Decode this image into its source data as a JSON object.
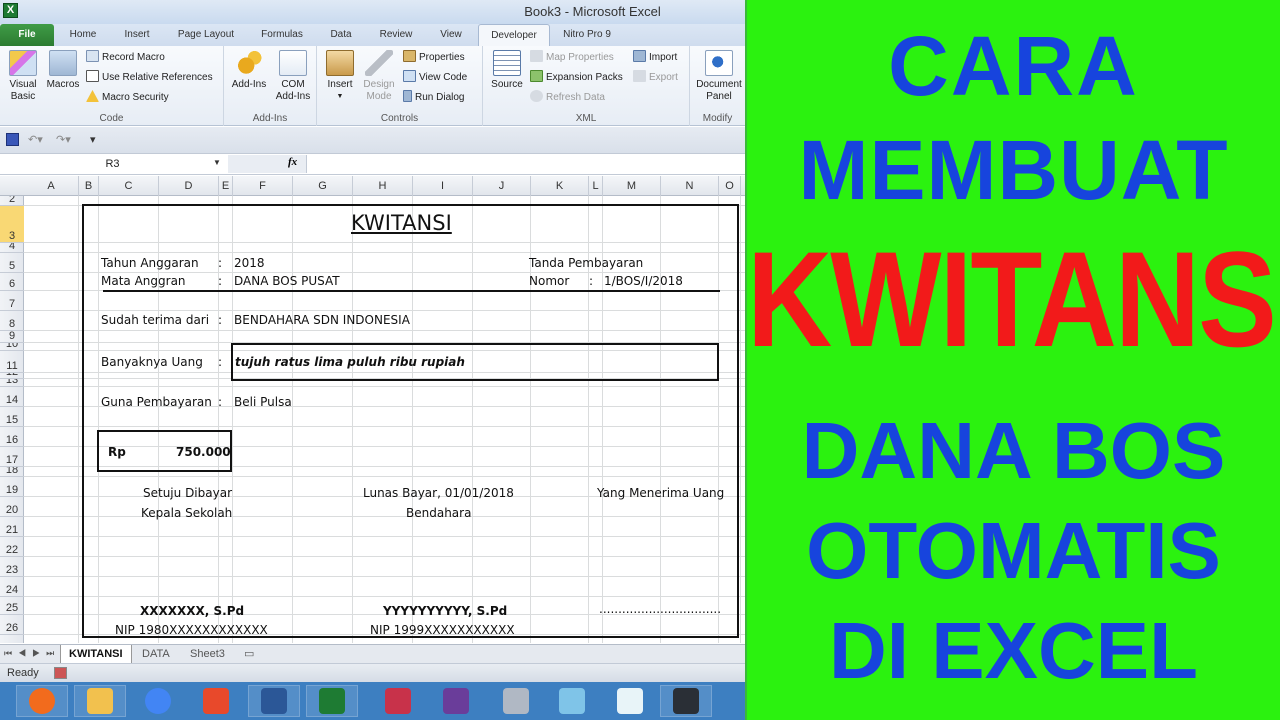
{
  "window": {
    "title": "Book3 - Microsoft Excel",
    "app_icon": "excel-icon"
  },
  "ribbon_tabs": [
    {
      "label": "File"
    },
    {
      "label": "Home"
    },
    {
      "label": "Insert"
    },
    {
      "label": "Page Layout"
    },
    {
      "label": "Formulas"
    },
    {
      "label": "Data"
    },
    {
      "label": "Review"
    },
    {
      "label": "View"
    },
    {
      "label": "Developer",
      "active": true
    },
    {
      "label": "Nitro Pro 9"
    }
  ],
  "ribbon": {
    "code": {
      "label": "Code",
      "visual_basic": "Visual Basic",
      "visual_basic_l1": "Visual",
      "visual_basic_l2": "Basic",
      "macros": "Macros",
      "record_macro": "Record Macro",
      "use_relative": "Use Relative References",
      "macro_security": "Macro Security"
    },
    "addins": {
      "label": "Add-Ins",
      "addins": "Add-Ins",
      "com_l1": "COM",
      "com_l2": "Add-Ins"
    },
    "controls": {
      "label": "Controls",
      "insert": "Insert",
      "design_l1": "Design",
      "design_l2": "Mode",
      "properties": "Properties",
      "view_code": "View Code",
      "run_dialog": "Run Dialog"
    },
    "xml": {
      "label": "XML",
      "source": "Source",
      "map_properties": "Map Properties",
      "expansion_packs": "Expansion Packs",
      "refresh_data": "Refresh Data",
      "import": "Import",
      "export": "Export"
    },
    "modify": {
      "label": "Modify",
      "doc_l1": "Document",
      "doc_l2": "Panel"
    }
  },
  "formula_bar": {
    "name_box": "R3",
    "fx": "fx",
    "formula": ""
  },
  "columns": [
    "A",
    "B",
    "C",
    "D",
    "E",
    "F",
    "G",
    "H",
    "I",
    "J",
    "K",
    "L",
    "M",
    "N",
    "O"
  ],
  "rows": [
    "2",
    "3",
    "4",
    "5",
    "6",
    "7",
    "8",
    "9",
    "10",
    "11",
    "12",
    "13",
    "14",
    "15",
    "16",
    "17",
    "18",
    "19",
    "20",
    "21",
    "22",
    "23",
    "24",
    "25",
    "26"
  ],
  "selected_row": "3",
  "receipt": {
    "title": "KWITANSI",
    "tahun_label": "Tahun Anggaran",
    "tahun_value": "2018",
    "mata_label": "Mata Anggran",
    "mata_value": "DANA BOS PUSAT",
    "tanda_label": "Tanda Pembayaran",
    "nomor_label": "Nomor",
    "nomor_value": "1/BOS/I/2018",
    "sudah_label": "Sudah terima dari",
    "sudah_value": "BENDAHARA SDN INDONESIA",
    "banyak_label": "Banyaknya Uang",
    "banyak_value": "tujuh ratus lima puluh ribu rupiah",
    "guna_label": "Guna Pembayaran",
    "guna_value": "Beli Pulsa",
    "colon": ":",
    "rp_label": "Rp",
    "rp_value": "750.000",
    "setuju": "Setuju Dibayar",
    "kepala": "Kepala Sekolah",
    "lunas": "Lunas Bayar, 01/01/2018",
    "bendahara": "Bendahara",
    "penerima": "Yang Menerima Uang",
    "name1": "XXXXXXX, S.Pd",
    "nip1": "NIP 1980XXXXXXXXXXXX",
    "name2": "YYYYYYYYYY, S.Pd",
    "nip2": "NIP 1999XXXXXXXXXXX",
    "name3": "................................"
  },
  "sheet_tabs": [
    {
      "label": "KWITANSI",
      "active": true
    },
    {
      "label": "DATA"
    },
    {
      "label": "Sheet3"
    }
  ],
  "status": {
    "ready": "Ready"
  },
  "taskbar": [
    {
      "name": "firefox-icon",
      "color": "#f26b1d"
    },
    {
      "name": "file-explorer-icon",
      "color": "#f2c14e"
    },
    {
      "name": "chrome-icon",
      "color": "#4285f4"
    },
    {
      "name": "pdf-reader-icon",
      "color": "#e8492b"
    },
    {
      "name": "word-icon",
      "color": "#2b5797"
    },
    {
      "name": "excel-icon",
      "color": "#1e7b33"
    },
    {
      "name": "spss-icon",
      "color": "#c8324a"
    },
    {
      "name": "video-editor-icon",
      "color": "#6a3d9a"
    },
    {
      "name": "database-icon",
      "color": "#b0b8c4"
    },
    {
      "name": "notepad-icon",
      "color": "#7fc4e8"
    },
    {
      "name": "screen-recorder-icon",
      "color": "#e8f4f8"
    },
    {
      "name": "filmora-icon",
      "color": "#2a2f36"
    }
  ],
  "panel": {
    "line1": "CARA",
    "line2": "MEMBUAT",
    "line3": "KWITANSI",
    "line4": "DANA BOS",
    "line5": "OTOMATIS",
    "line6": "DI EXCEL",
    "blue": "#1744dd",
    "red": "#f21a1a",
    "background": "#2bf20f"
  }
}
